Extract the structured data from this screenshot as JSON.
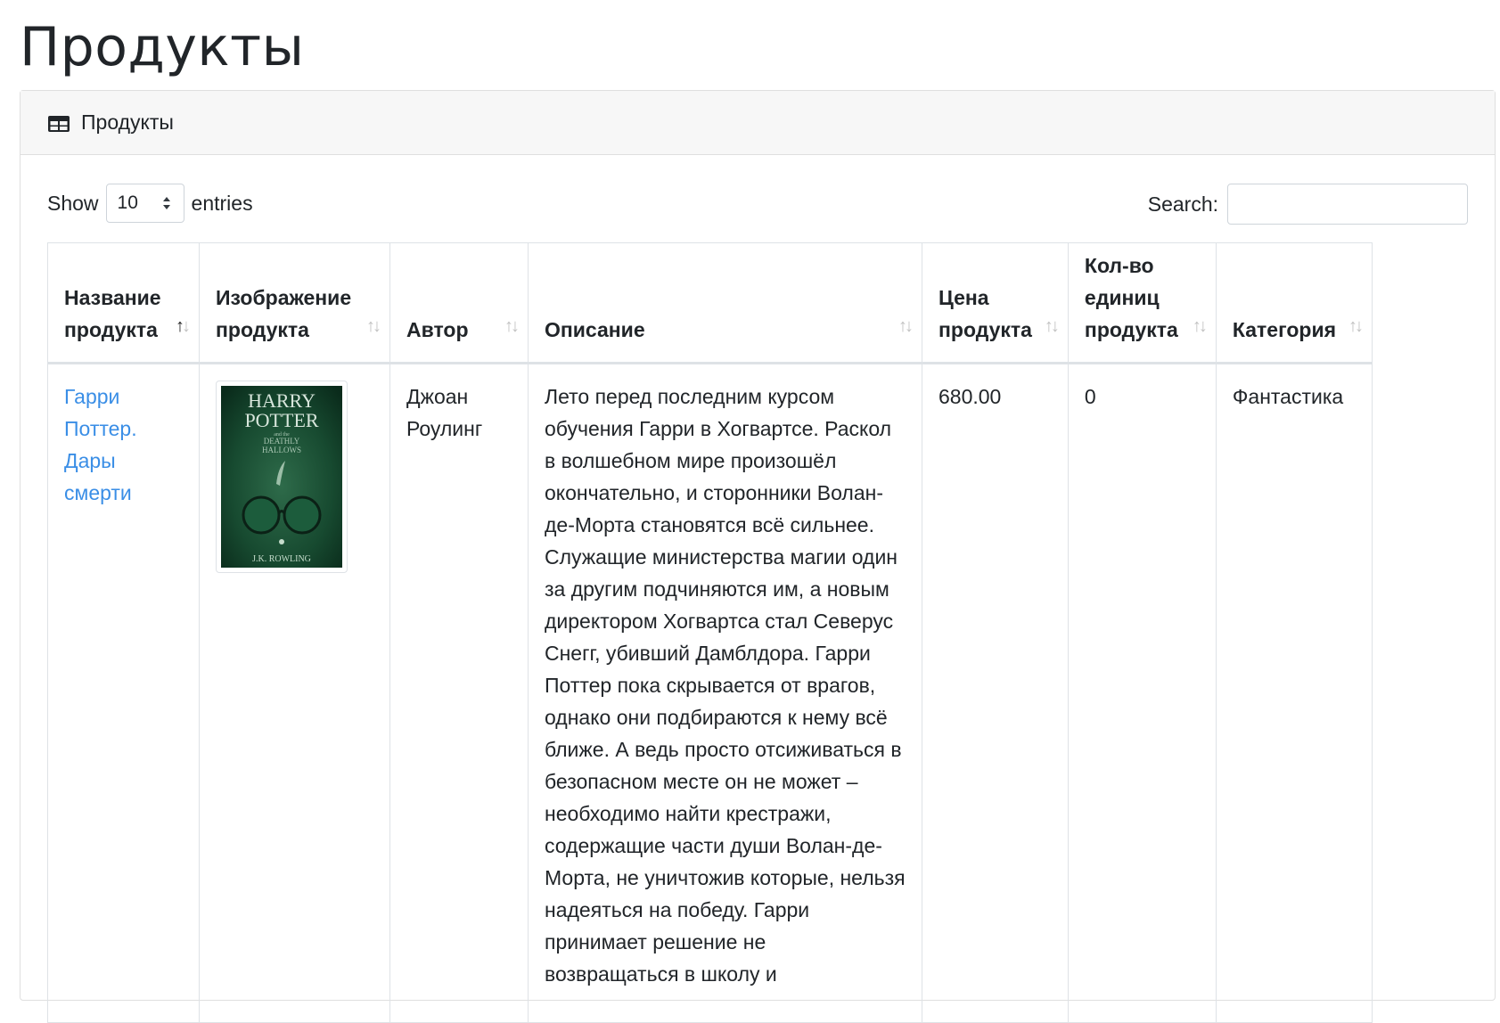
{
  "page": {
    "title": "Продукты"
  },
  "card": {
    "header": "Продукты",
    "header_icon": "table-icon"
  },
  "controls": {
    "show_label": "Show",
    "entries_value": "10",
    "entries_label": "entries",
    "search_label": "Search:",
    "search_value": ""
  },
  "table": {
    "columns": [
      {
        "label": "Название продукта",
        "sort": "asc"
      },
      {
        "label": "Изображение продукта",
        "sort": "none"
      },
      {
        "label": "Автор",
        "sort": "none"
      },
      {
        "label": "Описание",
        "sort": "none"
      },
      {
        "label": "Цена продукта",
        "sort": "none"
      },
      {
        "label": "Кол-во единиц продукта",
        "sort": "none"
      },
      {
        "label": "Категория",
        "sort": "none"
      }
    ],
    "rows": [
      {
        "name": "Гарри Поттер. Дары смерти",
        "image": {
          "title_line1": "HARRY",
          "title_line2": "POTTER",
          "subtitle_small": "and the",
          "subtitle_line1": "DEATHLY",
          "subtitle_line2": "HALLOWS",
          "author": "J.K. ROWLING"
        },
        "author": "Джоан Роулинг",
        "description": "Лето перед последним курсом обучения Гарри в Хогвартсе. Раскол в волшебном мире произошёл окончательно, и сторонники Волан-де-Морта становятся всё сильнее. Служащие министерства магии один за другим подчиняются им, а новым директором Хогвартса стал Северус Снегг, убивший Дамблдора. Гарри Поттер пока скрывается от врагов, однако они подбираются к нему всё ближе. А ведь просто отсиживаться в безопасном месте он не может – необходимо найти крестражи, содержащие части души Волан-де-Морта, не уничтожив которые, нельзя надеяться на победу. Гарри принимает решение не возвращаться в школу и",
        "price": "680.00",
        "quantity": "0",
        "category": "Фантастика"
      }
    ]
  },
  "colors": {
    "link": "#3a8ee6",
    "header_bg": "#f7f7f7",
    "border": "#dee2e6"
  }
}
